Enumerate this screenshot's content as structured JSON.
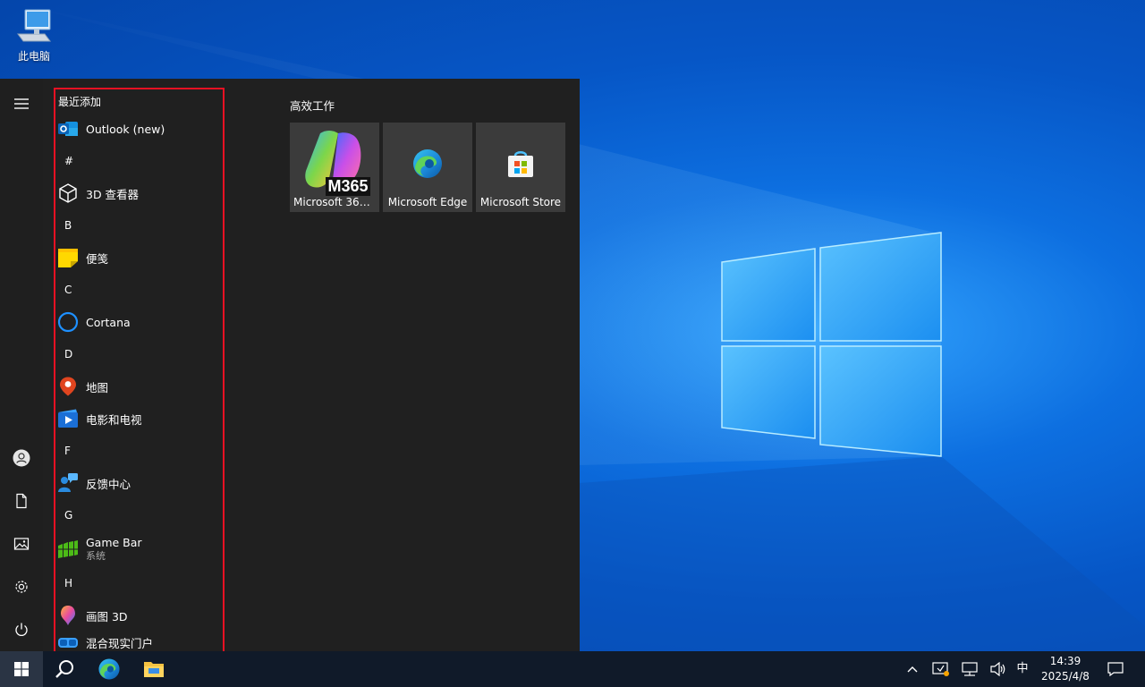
{
  "desktop": {
    "icons": [
      {
        "label": "此电脑",
        "icon": "this-pc-icon"
      }
    ]
  },
  "start_menu": {
    "rail": {
      "top": [
        {
          "icon": "hamburger-icon"
        }
      ],
      "bottom": [
        {
          "icon": "user-icon"
        },
        {
          "icon": "document-icon"
        },
        {
          "icon": "pictures-icon"
        },
        {
          "icon": "settings-gear-icon"
        },
        {
          "icon": "power-icon"
        }
      ]
    },
    "app_list": {
      "recent_header": "最近添加",
      "entries": [
        {
          "kind": "app",
          "label": "Outlook (new)",
          "icon": "outlook-icon"
        },
        {
          "kind": "letter",
          "label": "#"
        },
        {
          "kind": "app",
          "label": "3D 查看器",
          "icon": "3d-viewer-icon"
        },
        {
          "kind": "letter",
          "label": "B"
        },
        {
          "kind": "app",
          "label": "便笺",
          "icon": "sticky-notes-icon"
        },
        {
          "kind": "letter",
          "label": "C"
        },
        {
          "kind": "app",
          "label": "Cortana",
          "icon": "cortana-icon"
        },
        {
          "kind": "letter",
          "label": "D"
        },
        {
          "kind": "app",
          "label": "地图",
          "icon": "maps-icon"
        },
        {
          "kind": "app",
          "label": "电影和电视",
          "icon": "movies-tv-icon"
        },
        {
          "kind": "letter",
          "label": "F"
        },
        {
          "kind": "app",
          "label": "反馈中心",
          "icon": "feedback-hub-icon"
        },
        {
          "kind": "letter",
          "label": "G"
        },
        {
          "kind": "app",
          "label": "Game Bar",
          "sub": "系统",
          "icon": "game-bar-icon"
        },
        {
          "kind": "letter",
          "label": "H"
        },
        {
          "kind": "app",
          "label": "画图 3D",
          "icon": "paint-3d-icon"
        },
        {
          "kind": "app",
          "label": "混合现实门户",
          "icon": "mixed-reality-icon"
        }
      ]
    },
    "tiles": {
      "group_title": "高效工作",
      "items": [
        {
          "label": "Microsoft 365...",
          "badge": "M365",
          "icon": "m365-copilot-icon"
        },
        {
          "label": "Microsoft Edge",
          "icon": "edge-icon"
        },
        {
          "label": "Microsoft Store",
          "icon": "store-icon"
        }
      ]
    }
  },
  "taskbar": {
    "pinned": [
      {
        "icon": "windows-start-icon"
      },
      {
        "icon": "search-icon"
      },
      {
        "icon": "edge-icon"
      },
      {
        "icon": "file-explorer-icon"
      }
    ],
    "tray": {
      "icons": [
        "chevron-up-icon",
        "security-center-icon",
        "network-icon",
        "volume-icon"
      ],
      "ime": "中",
      "time": "14:39",
      "date": "2025/4/8",
      "notification": "notification-icon"
    }
  },
  "colors": {
    "start_bg": "#202020",
    "tile_bg": "#3b3b3b",
    "highlight_border": "#e81123",
    "taskbar_bg": "#101a29"
  }
}
